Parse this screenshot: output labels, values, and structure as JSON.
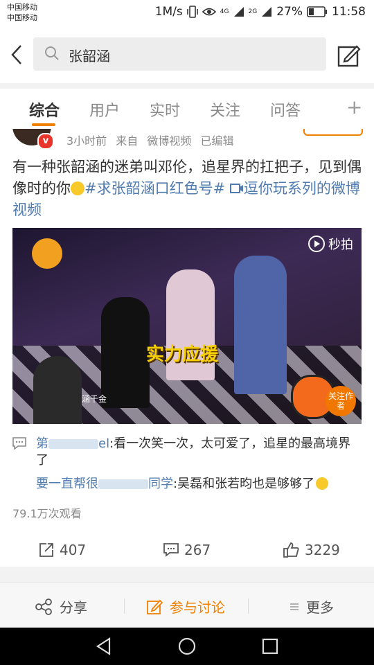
{
  "status": {
    "carrier1": "中国移动",
    "carrier2": "中国移动",
    "speed": "1M/s",
    "net1": "4G",
    "net2": "2G",
    "battery": "27%",
    "time": "11:58"
  },
  "search": {
    "query": "张韶涵"
  },
  "tabs": [
    {
      "label": "综合"
    },
    {
      "label": "用户"
    },
    {
      "label": "实时"
    },
    {
      "label": "关注"
    },
    {
      "label": "问答"
    }
  ],
  "post": {
    "time_ago": "3小时前",
    "source": "来自 微博视频",
    "edited": "已编辑",
    "text_main": "有一种张韶涵的迷弟叫邓伦，追星界的扛把子，见到偶像时的你",
    "text_hashtag": "#求张韶涵口红色号#",
    "text_link": "逗你玩系列的微博视频",
    "video": {
      "logo_text": "秒拍",
      "caption": "实力应援",
      "name_tag": "涵千金",
      "follow_author": "关注作者"
    },
    "comments": [
      {
        "user_start": "第",
        "user_end": "el",
        "text": ":看一次笑一次，太可爱了，追星的最高境界了"
      },
      {
        "user_start": "要一直帮很",
        "user_end": "同学",
        "text": ":吴磊和张若昀也是够够了"
      }
    ],
    "views": "79.1万次观看",
    "actions": {
      "share": "407",
      "comment": "267",
      "like": "3229"
    }
  },
  "bottombar": {
    "share": "分享",
    "discuss": "参与讨论",
    "more": "更多"
  },
  "colors": {
    "accent": "#f08000",
    "link": "#4f7bb0"
  }
}
